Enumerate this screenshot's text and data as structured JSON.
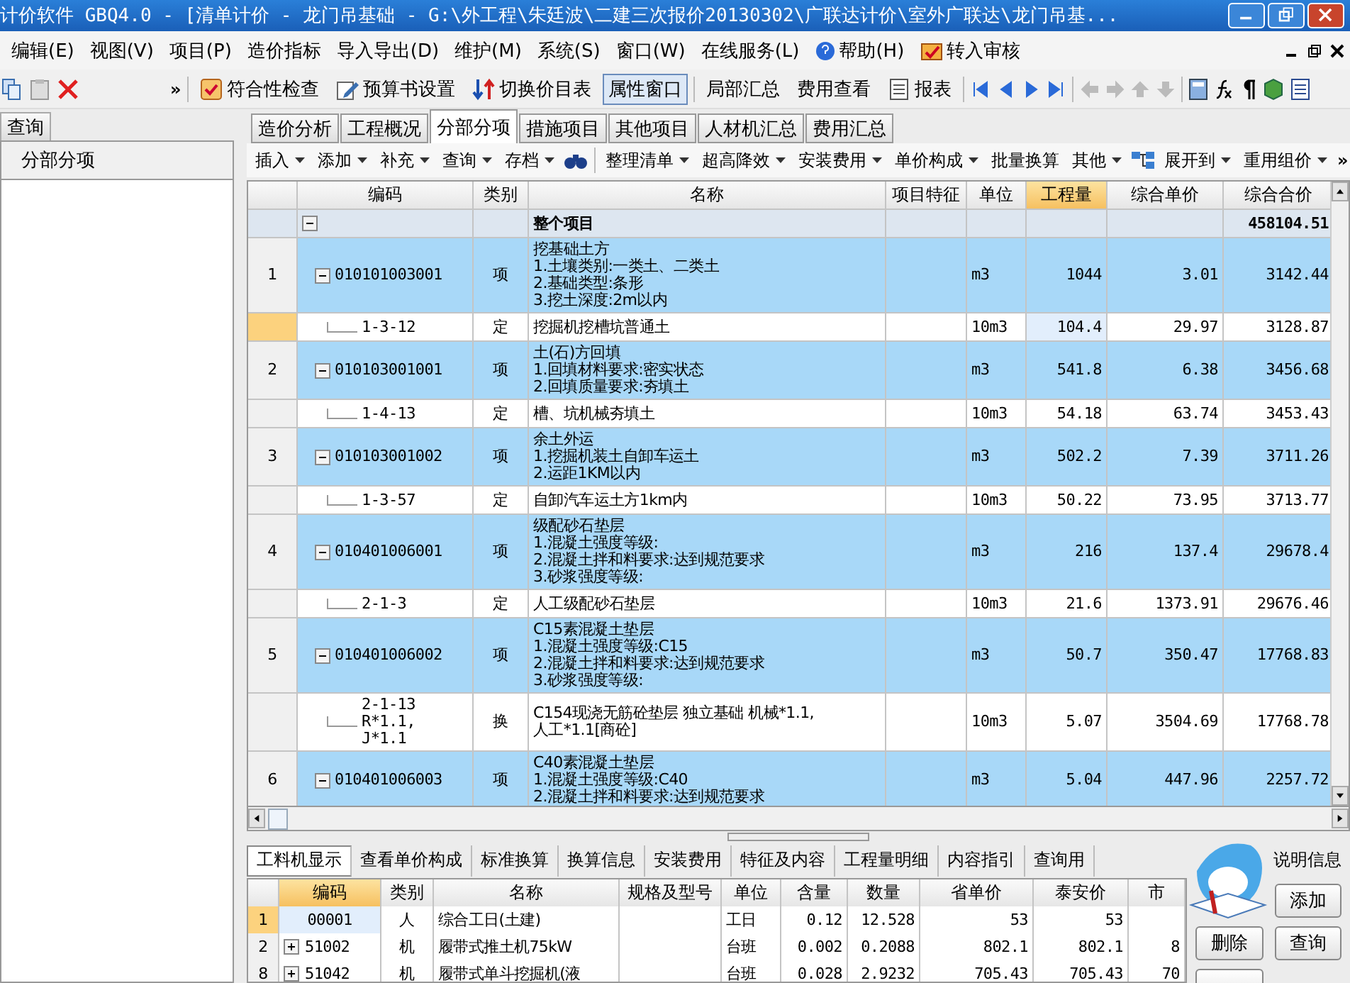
{
  "window": {
    "title": "计价软件 GBQ4.0 - [清单计价 - 龙门吊基础 - G:\\外工程\\朱廷波\\二建三次报价20130302\\广联达计价\\室外广联达\\龙门吊基..."
  },
  "menu": [
    "编辑(E)",
    "视图(V)",
    "项目(P)",
    "造价指标",
    "导入导出(D)",
    "维护(M)",
    "系统(S)",
    "窗口(W)",
    "在线服务(L)",
    "帮助(H)",
    "转入审核"
  ],
  "toolbar": {
    "overflow": "»",
    "items": [
      {
        "label": "符合性检查",
        "pressed": false
      },
      {
        "label": "预算书设置",
        "pressed": false
      },
      {
        "label": "切换价目表",
        "pressed": false
      },
      {
        "label": "属性窗口",
        "pressed": true
      },
      {
        "label": "局部汇总",
        "pressed": false
      },
      {
        "label": "费用查看",
        "pressed": false
      },
      {
        "label": "报表",
        "pressed": false
      }
    ]
  },
  "left_panel": {
    "tab": "查询",
    "header": "分部分项"
  },
  "tabs": [
    {
      "label": "造价分析",
      "selected": false
    },
    {
      "label": "工程概况",
      "selected": false
    },
    {
      "label": "分部分项",
      "selected": true
    },
    {
      "label": "措施项目",
      "selected": false
    },
    {
      "label": "其他项目",
      "selected": false
    },
    {
      "label": "人材机汇总",
      "selected": false
    },
    {
      "label": "费用汇总",
      "selected": false
    }
  ],
  "subtoolbar": {
    "overflow": "»",
    "items": [
      {
        "label": "插入",
        "dropdown": true
      },
      {
        "label": "添加",
        "dropdown": true
      },
      {
        "label": "补充",
        "dropdown": true
      },
      {
        "label": "查询",
        "dropdown": true
      },
      {
        "label": "存档",
        "dropdown": true
      },
      {
        "label": "整理清单",
        "dropdown": true
      },
      {
        "label": "超高降效",
        "dropdown": true
      },
      {
        "label": "安装费用",
        "dropdown": true
      },
      {
        "label": "单价构成",
        "dropdown": true
      },
      {
        "label": "批量换算",
        "dropdown": false
      },
      {
        "label": "其他",
        "dropdown": true
      },
      {
        "label": "展开到",
        "dropdown": true
      },
      {
        "label": "重用组价",
        "dropdown": true
      }
    ]
  },
  "grid": {
    "columns": [
      {
        "label": "编码",
        "selected": false
      },
      {
        "label": "类别",
        "selected": false
      },
      {
        "label": "名称",
        "selected": false
      },
      {
        "label": "项目特征",
        "selected": false
      },
      {
        "label": "单位",
        "selected": false
      },
      {
        "label": "工程量",
        "selected": true
      },
      {
        "label": "综合单价",
        "selected": false
      },
      {
        "label": "综合合价",
        "selected": false
      }
    ],
    "total_row": {
      "name": "整个项目",
      "total": "458104.51"
    },
    "rows": [
      {
        "kind": "item",
        "num": "1",
        "code": "010101003001",
        "type": "项",
        "name": "挖基础土方\n1.土壤类别:一类土、二类土\n2.基础类型:条形\n3.挖土深度:2m以内",
        "unit": "m3",
        "qty": "1044",
        "price": "3.01",
        "total": "3142.44",
        "selected": false
      },
      {
        "kind": "quota",
        "code": "1-3-12",
        "type": "定",
        "name": "挖掘机挖槽坑普通土",
        "unit": "10m3",
        "qty": "104.4",
        "price": "29.97",
        "total": "3128.87",
        "selected": true
      },
      {
        "kind": "item",
        "num": "2",
        "code": "010103001001",
        "type": "项",
        "name": "土(石)方回填\n1.回填材料要求:密实状态\n2.回填质量要求:夯填土",
        "unit": "m3",
        "qty": "541.8",
        "price": "6.38",
        "total": "3456.68",
        "selected": false
      },
      {
        "kind": "quota",
        "code": "1-4-13",
        "type": "定",
        "name": "槽、坑机械夯填土",
        "unit": "10m3",
        "qty": "54.18",
        "price": "63.74",
        "total": "3453.43",
        "selected": false
      },
      {
        "kind": "item",
        "num": "3",
        "code": "010103001002",
        "type": "项",
        "name": "余土外运\n1.挖掘机装土自卸车运土\n2.运距1KM以内",
        "unit": "m3",
        "qty": "502.2",
        "price": "7.39",
        "total": "3711.26",
        "selected": false
      },
      {
        "kind": "quota",
        "code": "1-3-57",
        "type": "定",
        "name": "自卸汽车运土方1km内",
        "unit": "10m3",
        "qty": "50.22",
        "price": "73.95",
        "total": "3713.77",
        "selected": false
      },
      {
        "kind": "item",
        "num": "4",
        "code": "010401006001",
        "type": "项",
        "name": "级配砂石垫层\n1.混凝土强度等级:\n2.混凝土拌和料要求:达到规范要求\n3.砂浆强度等级:",
        "unit": "m3",
        "qty": "216",
        "price": "137.4",
        "total": "29678.4",
        "selected": false
      },
      {
        "kind": "quota",
        "code": "2-1-3",
        "type": "定",
        "name": "人工级配砂石垫层",
        "unit": "10m3",
        "qty": "21.6",
        "price": "1373.91",
        "total": "29676.46",
        "selected": false
      },
      {
        "kind": "item",
        "num": "5",
        "code": "010401006002",
        "type": "项",
        "name": "C15素混凝土垫层\n1.混凝土强度等级:C15\n2.混凝土拌和料要求:达到规范要求\n3.砂浆强度等级:",
        "unit": "m3",
        "qty": "50.7",
        "price": "350.47",
        "total": "17768.83",
        "selected": false
      },
      {
        "kind": "quota",
        "code": "2-1-13 R*1.1,\nJ*1.1",
        "type": "换",
        "name": "C154现浇无筋砼垫层 独立基础 机械*1.1,\n人工*1.1[商砼]",
        "unit": "10m3",
        "qty": "5.07",
        "price": "3504.69",
        "total": "17768.78",
        "selected": false
      },
      {
        "kind": "item",
        "num": "6",
        "code": "010401006003",
        "type": "项",
        "name": "C40素混凝土垫层\n1.混凝土强度等级:C40\n2.混凝土拌和料要求:达到规范要求",
        "unit": "m3",
        "qty": "5.04",
        "price": "447.96",
        "total": "2257.72",
        "selected": false
      }
    ]
  },
  "bottom_tabs": [
    {
      "label": "工料机显示",
      "selected": true
    },
    {
      "label": "查看单价构成",
      "selected": false
    },
    {
      "label": "标准换算",
      "selected": false
    },
    {
      "label": "换算信息",
      "selected": false
    },
    {
      "label": "安装费用",
      "selected": false
    },
    {
      "label": "特征及内容",
      "selected": false
    },
    {
      "label": "工程量明细",
      "selected": false
    },
    {
      "label": "内容指引",
      "selected": false
    },
    {
      "label": "查询用",
      "selected": false
    },
    {
      "label": "说明信息",
      "selected": false
    }
  ],
  "bottom_grid": {
    "columns": [
      {
        "label": "编码",
        "selected": true
      },
      {
        "label": "类别",
        "selected": false
      },
      {
        "label": "名称",
        "selected": false
      },
      {
        "label": "规格及型号",
        "selected": false
      },
      {
        "label": "单位",
        "selected": false
      },
      {
        "label": "含量",
        "selected": false
      },
      {
        "label": "数量",
        "selected": false
      },
      {
        "label": "省单价",
        "selected": false
      },
      {
        "label": "泰安价",
        "selected": false
      },
      {
        "label": "市",
        "selected": false
      }
    ],
    "rows": [
      {
        "num": "1",
        "expandable": false,
        "code": "00001",
        "type": "人",
        "name": "综合工日(土建)",
        "unit": "工日",
        "content": "0.12",
        "amount": "12.528",
        "prov": "53",
        "local": "53",
        "selected": true
      },
      {
        "num": "2",
        "expandable": true,
        "code": "51002",
        "type": "机",
        "name": "履带式推土机75kW",
        "unit": "台班",
        "content": "0.002",
        "amount": "0.2088",
        "prov": "802.1",
        "local": "802.1",
        "market": "8",
        "selected": false
      },
      {
        "num": "8",
        "expandable": true,
        "code": "51042",
        "type": "机",
        "name": "履带式单斗挖掘机(液",
        "unit": "台班",
        "content": "0.028",
        "amount": "2.9232",
        "prov": "705.43",
        "local": "705.43",
        "market": "70",
        "selected": false
      }
    ]
  },
  "side_buttons": [
    "添加",
    "删除",
    "查询"
  ]
}
